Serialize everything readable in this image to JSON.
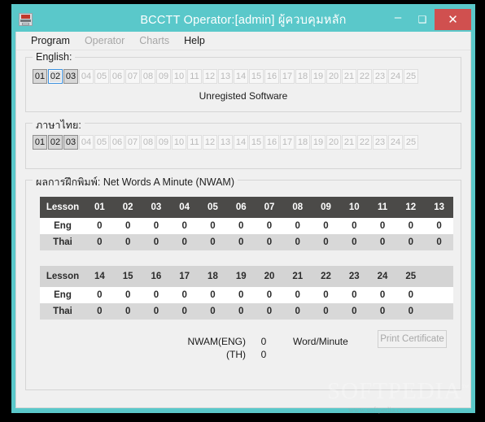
{
  "window": {
    "title": "BCCTT Operator:[admin] ผู้ควบคุมหลัก",
    "icon": "typewriter-icon",
    "frame_color": "#5ac8ca",
    "close_color": "#d0504f",
    "controls": {
      "minimize": "–",
      "maximize": "❑",
      "close": "✕"
    }
  },
  "menubar": {
    "items": [
      {
        "label": "Program",
        "enabled": true
      },
      {
        "label": "Operator",
        "enabled": false
      },
      {
        "label": "Charts",
        "enabled": false
      },
      {
        "label": "Help",
        "enabled": true
      }
    ]
  },
  "english_group": {
    "title": "English:",
    "buttons": [
      {
        "label": "01",
        "state": "enabled"
      },
      {
        "label": "02",
        "state": "focused"
      },
      {
        "label": "03",
        "state": "enabled"
      },
      {
        "label": "04",
        "state": "disabled"
      },
      {
        "label": "05",
        "state": "disabled"
      },
      {
        "label": "06",
        "state": "disabled"
      },
      {
        "label": "07",
        "state": "disabled"
      },
      {
        "label": "08",
        "state": "disabled"
      },
      {
        "label": "09",
        "state": "disabled"
      },
      {
        "label": "10",
        "state": "disabled"
      },
      {
        "label": "11",
        "state": "disabled"
      },
      {
        "label": "12",
        "state": "disabled"
      },
      {
        "label": "13",
        "state": "disabled"
      },
      {
        "label": "14",
        "state": "disabled"
      },
      {
        "label": "15",
        "state": "disabled"
      },
      {
        "label": "16",
        "state": "disabled"
      },
      {
        "label": "17",
        "state": "disabled"
      },
      {
        "label": "18",
        "state": "disabled"
      },
      {
        "label": "19",
        "state": "disabled"
      },
      {
        "label": "20",
        "state": "disabled"
      },
      {
        "label": "21",
        "state": "disabled"
      },
      {
        "label": "22",
        "state": "disabled"
      },
      {
        "label": "23",
        "state": "disabled"
      },
      {
        "label": "24",
        "state": "disabled"
      },
      {
        "label": "25",
        "state": "disabled"
      }
    ],
    "status_text": "Unregisted Software"
  },
  "thai_group": {
    "title": "ภาษาไทย:",
    "buttons": [
      {
        "label": "01",
        "state": "enabled"
      },
      {
        "label": "02",
        "state": "enabled"
      },
      {
        "label": "03",
        "state": "enabled"
      },
      {
        "label": "04",
        "state": "disabled"
      },
      {
        "label": "05",
        "state": "disabled"
      },
      {
        "label": "06",
        "state": "disabled"
      },
      {
        "label": "07",
        "state": "disabled"
      },
      {
        "label": "08",
        "state": "disabled"
      },
      {
        "label": "09",
        "state": "disabled"
      },
      {
        "label": "10",
        "state": "disabled"
      },
      {
        "label": "11",
        "state": "disabled"
      },
      {
        "label": "12",
        "state": "disabled"
      },
      {
        "label": "13",
        "state": "disabled"
      },
      {
        "label": "14",
        "state": "disabled"
      },
      {
        "label": "15",
        "state": "disabled"
      },
      {
        "label": "16",
        "state": "disabled"
      },
      {
        "label": "17",
        "state": "disabled"
      },
      {
        "label": "18",
        "state": "disabled"
      },
      {
        "label": "19",
        "state": "disabled"
      },
      {
        "label": "20",
        "state": "disabled"
      },
      {
        "label": "21",
        "state": "disabled"
      },
      {
        "label": "22",
        "state": "disabled"
      },
      {
        "label": "23",
        "state": "disabled"
      },
      {
        "label": "24",
        "state": "disabled"
      },
      {
        "label": "25",
        "state": "disabled"
      }
    ]
  },
  "nwam_group": {
    "title": "ผลการฝึกพิมพ์: Net Words A Minute (NWAM)",
    "tables": [
      {
        "header_style": "dark",
        "row_header": "Lesson",
        "columns": [
          "01",
          "02",
          "03",
          "04",
          "05",
          "06",
          "07",
          "08",
          "09",
          "10",
          "11",
          "12",
          "13"
        ],
        "rows": [
          {
            "label": "Eng",
            "values": [
              "0",
              "0",
              "0",
              "0",
              "0",
              "0",
              "0",
              "0",
              "0",
              "0",
              "0",
              "0",
              "0"
            ]
          },
          {
            "label": "Thai",
            "values": [
              "0",
              "0",
              "0",
              "0",
              "0",
              "0",
              "0",
              "0",
              "0",
              "0",
              "0",
              "0",
              "0"
            ]
          }
        ]
      },
      {
        "header_style": "light",
        "row_header": "Lesson",
        "columns": [
          "14",
          "15",
          "16",
          "17",
          "18",
          "19",
          "20",
          "21",
          "22",
          "23",
          "24",
          "25",
          ""
        ],
        "rows": [
          {
            "label": "Eng",
            "values": [
              "0",
              "0",
              "0",
              "0",
              "0",
              "0",
              "0",
              "0",
              "0",
              "0",
              "0",
              "0",
              ""
            ]
          },
          {
            "label": "Thai",
            "values": [
              "0",
              "0",
              "0",
              "0",
              "0",
              "0",
              "0",
              "0",
              "0",
              "0",
              "0",
              "0",
              ""
            ]
          }
        ]
      }
    ],
    "summary": {
      "eng_label": "NWAM(ENG)",
      "eng_value": "0",
      "th_label": "(TH)",
      "th_value": "0",
      "unit": "Word/Minute"
    },
    "print_button": "Print Certificate"
  },
  "watermark": {
    "main": "SOFTPEDIA",
    "trademark": "™",
    "sub": "www.softpedia.com"
  }
}
